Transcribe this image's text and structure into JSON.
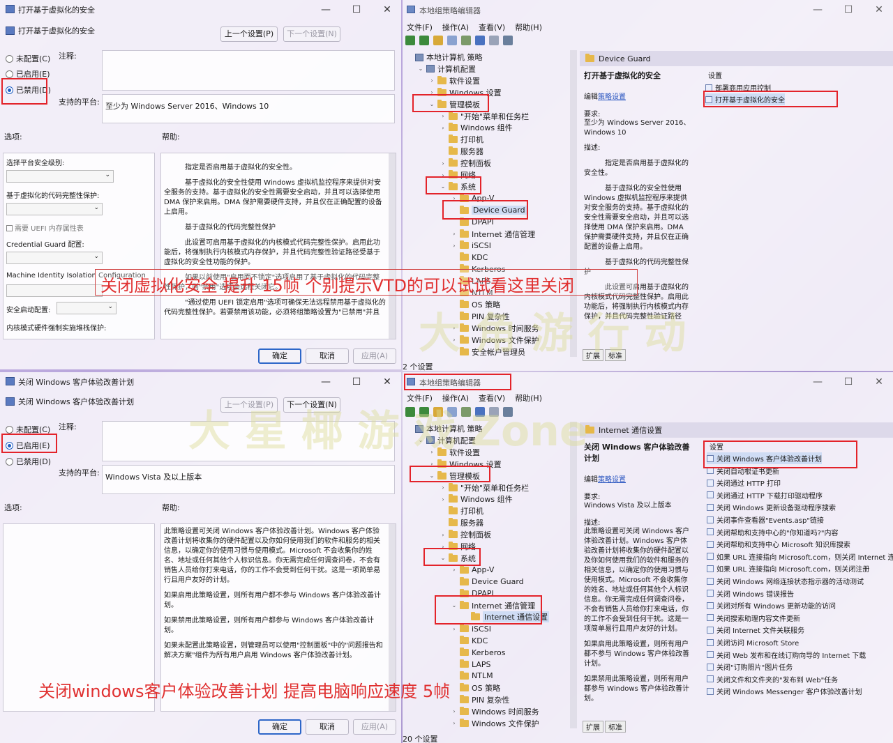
{
  "tl": {
    "title": "打开基于虚拟化的安全",
    "header_title": "打开基于虚拟化的安全",
    "prev_btn": "上一个设置(P)",
    "next_btn": "下一个设置(N)",
    "radio_not_configured": "未配置(C)",
    "radio_enabled": "已启用(E)",
    "radio_disabled": "已禁用(D)",
    "comment_label": "注释:",
    "platform_label": "支持的平台:",
    "platform_value": "至少为 Windows Server 2016、Windows 10",
    "options_label": "选项:",
    "help_label": "帮助:",
    "opt1": "选择平台安全级别:",
    "opt2": "基于虚拟化的代码完整性保护:",
    "opt3": "需要 UEFI 内存属性表",
    "opt4": "Credential Guard 配置:",
    "opt5": "Machine Identity Isolation Configuration",
    "opt6": "安全启动配置:",
    "opt7": "内核模式硬件强制实施堆栈保护:",
    "help_p1": "指定是否启用基于虚拟化的安全性。",
    "help_p2": "基于虚拟化的安全性使用 Windows 虚拟机监控程序来提供对安全服务的支持。基于虚拟化的安全性需要安全启动，并且可以选择使用 DMA 保护来启用。DMA 保护需要硬件支持，并且仅在正确配置的设备上启用。",
    "help_p3": "基于虚拟化的代码完整性保护",
    "help_p4": "此设置可启用基于虚拟化的内核模式代码完整性保护。启用此功能后，将强制执行内核模式内存保护，并且代码完整性验证路径受基于虚拟化的安全性功能的保护。",
    "help_p5": "如果以前使用\"启用而不锁定\"选项启用了基于虚拟化的代码完整性保护，则\"禁用\"选项会远程关闭它。",
    "help_p6": "\"通过使用 UEFI 锁定启用\"选项可确保无法远程禁用基于虚拟化的代码完整性保护。若要禁用该功能，必须将组策略设置为\"已禁用\"并且",
    "ok": "确定",
    "cancel": "取消",
    "apply": "应用(A)"
  },
  "tr": {
    "title": "本地组策略编辑器",
    "menu": [
      "文件(F)",
      "操作(A)",
      "查看(V)",
      "帮助(H)"
    ],
    "tree": [
      {
        "label": "本地计算机 策略",
        "indent": 0,
        "arrow": ""
      },
      {
        "label": "计算机配置",
        "indent": 1,
        "arrow": "⌄"
      },
      {
        "label": "软件设置",
        "indent": 2,
        "arrow": "›"
      },
      {
        "label": "Windows 设置",
        "indent": 2,
        "arrow": "›"
      },
      {
        "label": "管理模板",
        "indent": 2,
        "arrow": "⌄"
      },
      {
        "label": "\"开始\"菜单和任务栏",
        "indent": 3,
        "arrow": "›"
      },
      {
        "label": "Windows 组件",
        "indent": 3,
        "arrow": "›"
      },
      {
        "label": "打印机",
        "indent": 3,
        "arrow": ""
      },
      {
        "label": "服务器",
        "indent": 3,
        "arrow": ""
      },
      {
        "label": "控制面板",
        "indent": 3,
        "arrow": "›"
      },
      {
        "label": "网络",
        "indent": 3,
        "arrow": "›"
      },
      {
        "label": "系统",
        "indent": 3,
        "arrow": "⌄"
      },
      {
        "label": "App-V",
        "indent": 4,
        "arrow": "›"
      },
      {
        "label": "Device Guard",
        "indent": 4,
        "arrow": ""
      },
      {
        "label": "DPAPI",
        "indent": 4,
        "arrow": ""
      },
      {
        "label": "Internet 通信管理",
        "indent": 4,
        "arrow": "›"
      },
      {
        "label": "iSCSI",
        "indent": 4,
        "arrow": "›"
      },
      {
        "label": "KDC",
        "indent": 4,
        "arrow": ""
      },
      {
        "label": "Kerberos",
        "indent": 4,
        "arrow": ""
      },
      {
        "label": "LAPS",
        "indent": 4,
        "arrow": ""
      },
      {
        "label": "NTLM",
        "indent": 4,
        "arrow": ""
      },
      {
        "label": "OS 策略",
        "indent": 4,
        "arrow": ""
      },
      {
        "label": "PIN 复杂性",
        "indent": 4,
        "arrow": ""
      },
      {
        "label": "Windows 时间服务",
        "indent": 4,
        "arrow": "›"
      },
      {
        "label": "Windows 文件保护",
        "indent": 4,
        "arrow": "›"
      },
      {
        "label": "安全帐户管理员",
        "indent": 4,
        "arrow": ""
      }
    ],
    "folder_title": "Device Guard",
    "detail_title": "打开基于虚拟化的安全",
    "edit_prefix": "编辑",
    "edit_link": "策略设置",
    "req_label": "要求:",
    "req_value": "至少为 Windows Server 2016、Windows 10",
    "desc_label": "描述:",
    "desc_p1": "指定是否启用基于虚拟化的安全性。",
    "desc_p2": "基于虚拟化的安全性使用 Windows 虚拟机监控程序来提供对安全服务的支持。基于虚拟化的安全性需要安全启动，并且可以选择使用 DMA 保护来启用。DMA 保护需要硬件支持，并且仅在正确配置的设备上启用。",
    "desc_p3": "基于虚拟化的代码完整性保护",
    "desc_p4": "此设置可启用基于虚拟化的内核模式代码完整性保护。启用此功能后，将强制执行内核模式内存保护，并且代码完整性验证路径",
    "settings_header": "设置",
    "settings": [
      "部署商用应用控制",
      "打开基于虚拟化的安全"
    ],
    "tab_ext": "扩展",
    "tab_std": "标准",
    "status": "2 个设置"
  },
  "bl": {
    "title": "关闭 Windows 客户体验改善计划",
    "header_title": "关闭 Windows 客户体验改善计划",
    "prev_btn": "上一个设置(P)",
    "next_btn": "下一个设置(N)",
    "radio_not_configured": "未配置(C)",
    "radio_enabled": "已启用(E)",
    "radio_disabled": "已禁用(D)",
    "comment_label": "注释:",
    "platform_label": "支持的平台:",
    "platform_value": "Windows Vista 及以上版本",
    "options_label": "选项:",
    "help_label": "帮助:",
    "help_p1": "此策略设置可关闭 Windows 客户体验改善计划。Windows 客户体验改善计划将收集你的硬件配置以及你如何使用我们的软件和服务的相关信息，以确定你的使用习惯与使用模式。Microsoft 不会收集你的姓名、地址或任何其他个人标识信息。你无需完成任何调查问卷，不会有销售人员给你打来电话，你的工作不会受到任何干扰。这是一项简单易行且用户友好的计划。",
    "help_p2": "如果启用此策略设置，则所有用户都不参与 Windows 客户体验改善计划。",
    "help_p3": "如果禁用此策略设置，则所有用户都参与 Windows 客户体验改善计划。",
    "help_p4": "如果未配置此策略设置，则管理员可以使用\"控制面板\"中的\"问题报告和解决方案\"组件为所有用户启用 Windows 客户体验改善计划。",
    "ok": "确定",
    "cancel": "取消",
    "apply": "应用(A)"
  },
  "br": {
    "title": "本地组策略编辑器",
    "menu": [
      "文件(F)",
      "操作(A)",
      "查看(V)",
      "帮助(H)"
    ],
    "tree": [
      {
        "label": "本地计算机 策略",
        "indent": 0,
        "arrow": ""
      },
      {
        "label": "计算机配置",
        "indent": 1,
        "arrow": "⌄"
      },
      {
        "label": "软件设置",
        "indent": 2,
        "arrow": "›"
      },
      {
        "label": "Windows 设置",
        "indent": 2,
        "arrow": "›"
      },
      {
        "label": "管理模板",
        "indent": 2,
        "arrow": "⌄"
      },
      {
        "label": "\"开始\"菜单和任务栏",
        "indent": 3,
        "arrow": "›"
      },
      {
        "label": "Windows 组件",
        "indent": 3,
        "arrow": "›"
      },
      {
        "label": "打印机",
        "indent": 3,
        "arrow": ""
      },
      {
        "label": "服务器",
        "indent": 3,
        "arrow": ""
      },
      {
        "label": "控制面板",
        "indent": 3,
        "arrow": "›"
      },
      {
        "label": "网络",
        "indent": 3,
        "arrow": "›"
      },
      {
        "label": "系统",
        "indent": 3,
        "arrow": "⌄"
      },
      {
        "label": "App-V",
        "indent": 4,
        "arrow": "›"
      },
      {
        "label": "Device Guard",
        "indent": 4,
        "arrow": ""
      },
      {
        "label": "DPAPI",
        "indent": 4,
        "arrow": ""
      },
      {
        "label": "Internet 通信管理",
        "indent": 4,
        "arrow": "⌄"
      },
      {
        "label": "Internet 通信设置",
        "indent": 5,
        "arrow": ""
      },
      {
        "label": "iSCSI",
        "indent": 4,
        "arrow": "›"
      },
      {
        "label": "KDC",
        "indent": 4,
        "arrow": ""
      },
      {
        "label": "Kerberos",
        "indent": 4,
        "arrow": ""
      },
      {
        "label": "LAPS",
        "indent": 4,
        "arrow": ""
      },
      {
        "label": "NTLM",
        "indent": 4,
        "arrow": ""
      },
      {
        "label": "OS 策略",
        "indent": 4,
        "arrow": ""
      },
      {
        "label": "PIN 复杂性",
        "indent": 4,
        "arrow": ""
      },
      {
        "label": "Windows 时间服务",
        "indent": 4,
        "arrow": "›"
      },
      {
        "label": "Windows 文件保护",
        "indent": 4,
        "arrow": "›"
      }
    ],
    "folder_title": "Internet 通信设置",
    "detail_title": "关闭 Windows 客户体验改善计划",
    "edit_prefix": "编辑",
    "edit_link": "策略设置",
    "req_label": "要求:",
    "req_value": "Windows Vista 及以上版本",
    "desc_label": "描述:",
    "desc_p1": "此策略设置可关闭 Windows 客户体验改善计划。Windows 客户体验改善计划将收集你的硬件配置以及你如何使用我们的软件和服务的相关信息，以确定你的使用习惯与使用模式。Microsoft 不会收集你的姓名、地址或任何其他个人标识信息。你无需完成任何调查问卷，不会有销售人员给你打来电话，你的工作不会受到任何干扰。这是一项简单易行且用户友好的计划。",
    "desc_p2": "如果启用此策略设置，则所有用户都不参与 Windows 客户体验改善计划。",
    "desc_p3": "如果禁用此策略设置，则所有用户都参与 Windows 客户体验改善计划。",
    "settings_header": "设置",
    "settings": [
      "关闭 Windows 客户体验改善计划",
      "关闭自动根证书更新",
      "关闭通过 HTTP 打印",
      "关闭通过 HTTP 下载打印驱动程序",
      "关闭 Windows 更新设备驱动程序搜索",
      "关闭事件查看器\"Events.asp\"链接",
      "关闭帮助和支持中心的\"你知道吗?\"内容",
      "关闭帮助和支持中心 Microsoft 知识库搜索",
      "如果 URL 连接指向 Microsoft.com，则关闭 Internet 连",
      "如果 URL 连接指向 Microsoft.com，则关闭注册",
      "关闭 Windows 网络连接状态指示器的活动测试",
      "关闭 Windows 错误报告",
      "关闭对所有 Windows 更新功能的访问",
      "关闭搜索助理内容文件更新",
      "关闭 Internet 文件关联服务",
      "关闭访问 Microsoft Store",
      "关闭 Web 发布和在线订购向导的 Internet 下载",
      "关闭\"订购照片\"图片任务",
      "关闭文件和文件夹的\"发布到 Web\"任务",
      "关闭 Windows Messenger 客户体验改善计划"
    ],
    "tab_ext": "扩展",
    "tab_std": "标准",
    "status": "20 个设置"
  },
  "overlay_text_top": "关闭虚拟化安全 提升 15帧 个别提示VTD的可以试试看这里关闭",
  "overlay_text_bottom": "关闭windows客户体验改善计划 提高电脑响应速度 5帧",
  "watermark_top": "大 角 游 行 动",
  "watermark_bottom": "大 星 椰 游 戏 Zone",
  "colors": {
    "highlight": "#e3232a",
    "overlay_text": "#e03030",
    "accent_blue": "#2d66c8"
  }
}
